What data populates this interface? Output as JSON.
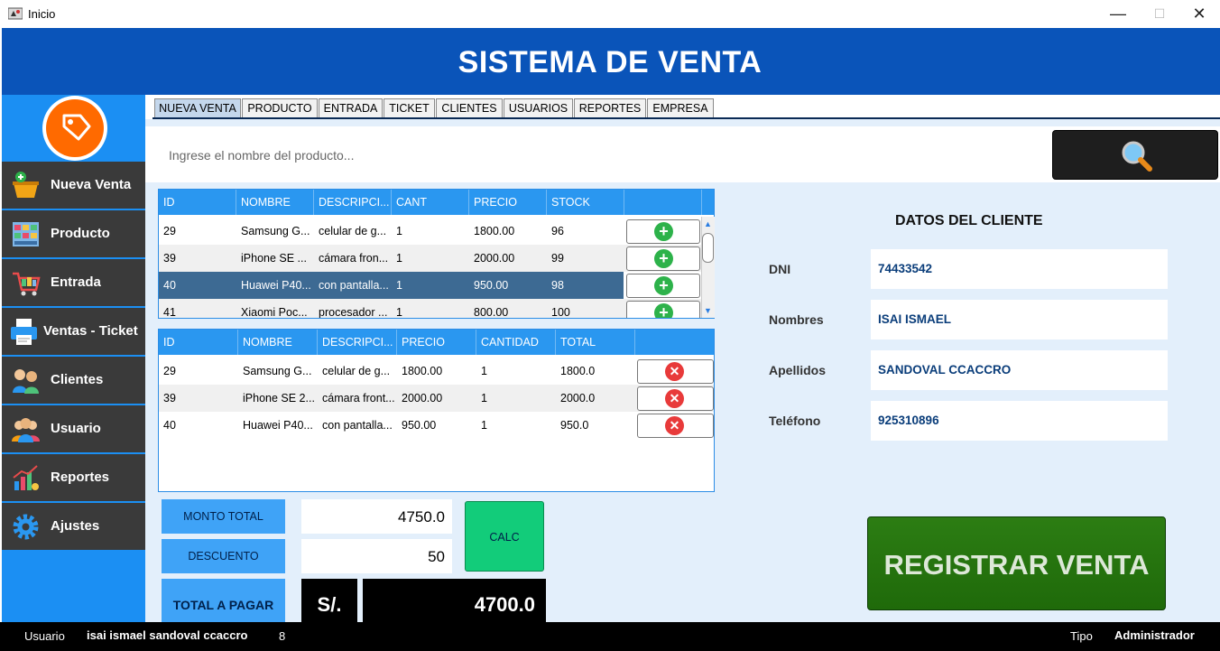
{
  "window": {
    "title": "Inicio",
    "minimize": "—",
    "maximize": "☐",
    "close": "✕"
  },
  "app_title": "SISTEMA DE VENTA",
  "sidebar": {
    "items": [
      {
        "label": "Nueva Venta",
        "icon": "basket-add-icon"
      },
      {
        "label": "Producto",
        "icon": "products-icon"
      },
      {
        "label": "Entrada",
        "icon": "shopping-cart-icon"
      },
      {
        "label": "Ventas - Ticket",
        "icon": "printer-icon"
      },
      {
        "label": "Clientes",
        "icon": "clients-icon"
      },
      {
        "label": "Usuario",
        "icon": "users-icon"
      },
      {
        "label": "Reportes",
        "icon": "chart-icon"
      },
      {
        "label": "Ajustes",
        "icon": "gear-icon"
      }
    ]
  },
  "tabs": [
    "NUEVA VENTA",
    "PRODUCTO",
    "ENTRADA",
    "TICKET",
    "CLIENTES",
    "USUARIOS",
    "REPORTES",
    "EMPRESA"
  ],
  "active_tab": "NUEVA VENTA",
  "search": {
    "placeholder": "Ingrese el nombre del producto..."
  },
  "products_table": {
    "columns": [
      "ID",
      "NOMBRE",
      "DESCRIPCI...",
      "CANT",
      "PRECIO",
      "STOCK",
      ""
    ],
    "rows": [
      {
        "id": "29",
        "nombre": "Samsung G...",
        "desc": "celular de g...",
        "cant": "1",
        "precio": "1800.00",
        "stock": "96"
      },
      {
        "id": "39",
        "nombre": "iPhone SE ...",
        "desc": "cámara fron...",
        "cant": "1",
        "precio": "2000.00",
        "stock": "99"
      },
      {
        "id": "40",
        "nombre": "Huawei P40...",
        "desc": "con pantalla...",
        "cant": "1",
        "precio": "950.00",
        "stock": "98"
      },
      {
        "id": "41",
        "nombre": "Xiaomi Poc...",
        "desc": "procesador ...",
        "cant": "1",
        "precio": "800.00",
        "stock": "100"
      }
    ],
    "selected_row": 2,
    "add_symbol": "+"
  },
  "cart_table": {
    "columns": [
      "ID",
      "NOMBRE",
      "DESCRIPCI...",
      "PRECIO",
      "CANTIDAD",
      "TOTAL",
      ""
    ],
    "rows": [
      {
        "id": "29",
        "nombre": "Samsung G...",
        "desc": "celular de g...",
        "precio": "1800.00",
        "cantidad": "1",
        "total": "1800.0"
      },
      {
        "id": "39",
        "nombre": "iPhone SE 2...",
        "desc": "cámara front...",
        "precio": "2000.00",
        "cantidad": "1",
        "total": "2000.0"
      },
      {
        "id": "40",
        "nombre": "Huawei P40...",
        "desc": "con pantalla...",
        "precio": "950.00",
        "cantidad": "1",
        "total": "950.0"
      }
    ],
    "delete_symbol": "✕"
  },
  "totals": {
    "monto_label": "MONTO TOTAL",
    "monto_value": "4750.0",
    "descuento_label": "DESCUENTO",
    "descuento_value": "50",
    "calc_label": "CALC",
    "total_label": "TOTAL A PAGAR",
    "currency": "S/.",
    "total_value": "4700.0"
  },
  "client": {
    "title": "DATOS DEL CLIENTE",
    "dni_label": "DNI",
    "dni": "74433542",
    "nombres_label": "Nombres",
    "nombres": "ISAI ISMAEL",
    "apellidos_label": "Apellidos",
    "apellidos": "SANDOVAL CCACCRO",
    "telefono_label": "Teléfono",
    "telefono": "925310896"
  },
  "register_label": "REGISTRAR VENTA",
  "status": {
    "usuario_label": "Usuario",
    "usuario": "isai ismael sandoval ccaccro",
    "id": "8",
    "tipo_label": "Tipo",
    "tipo": "Administrador"
  },
  "colors": {
    "header": "#0a54b9",
    "sidebar": "#1b8ff3",
    "nav_item": "#3a3a3a",
    "table_header": "#2a97f0",
    "selected_row": "#3d6a93",
    "register": "#1f6a0a",
    "calc": "#12cc7a"
  }
}
